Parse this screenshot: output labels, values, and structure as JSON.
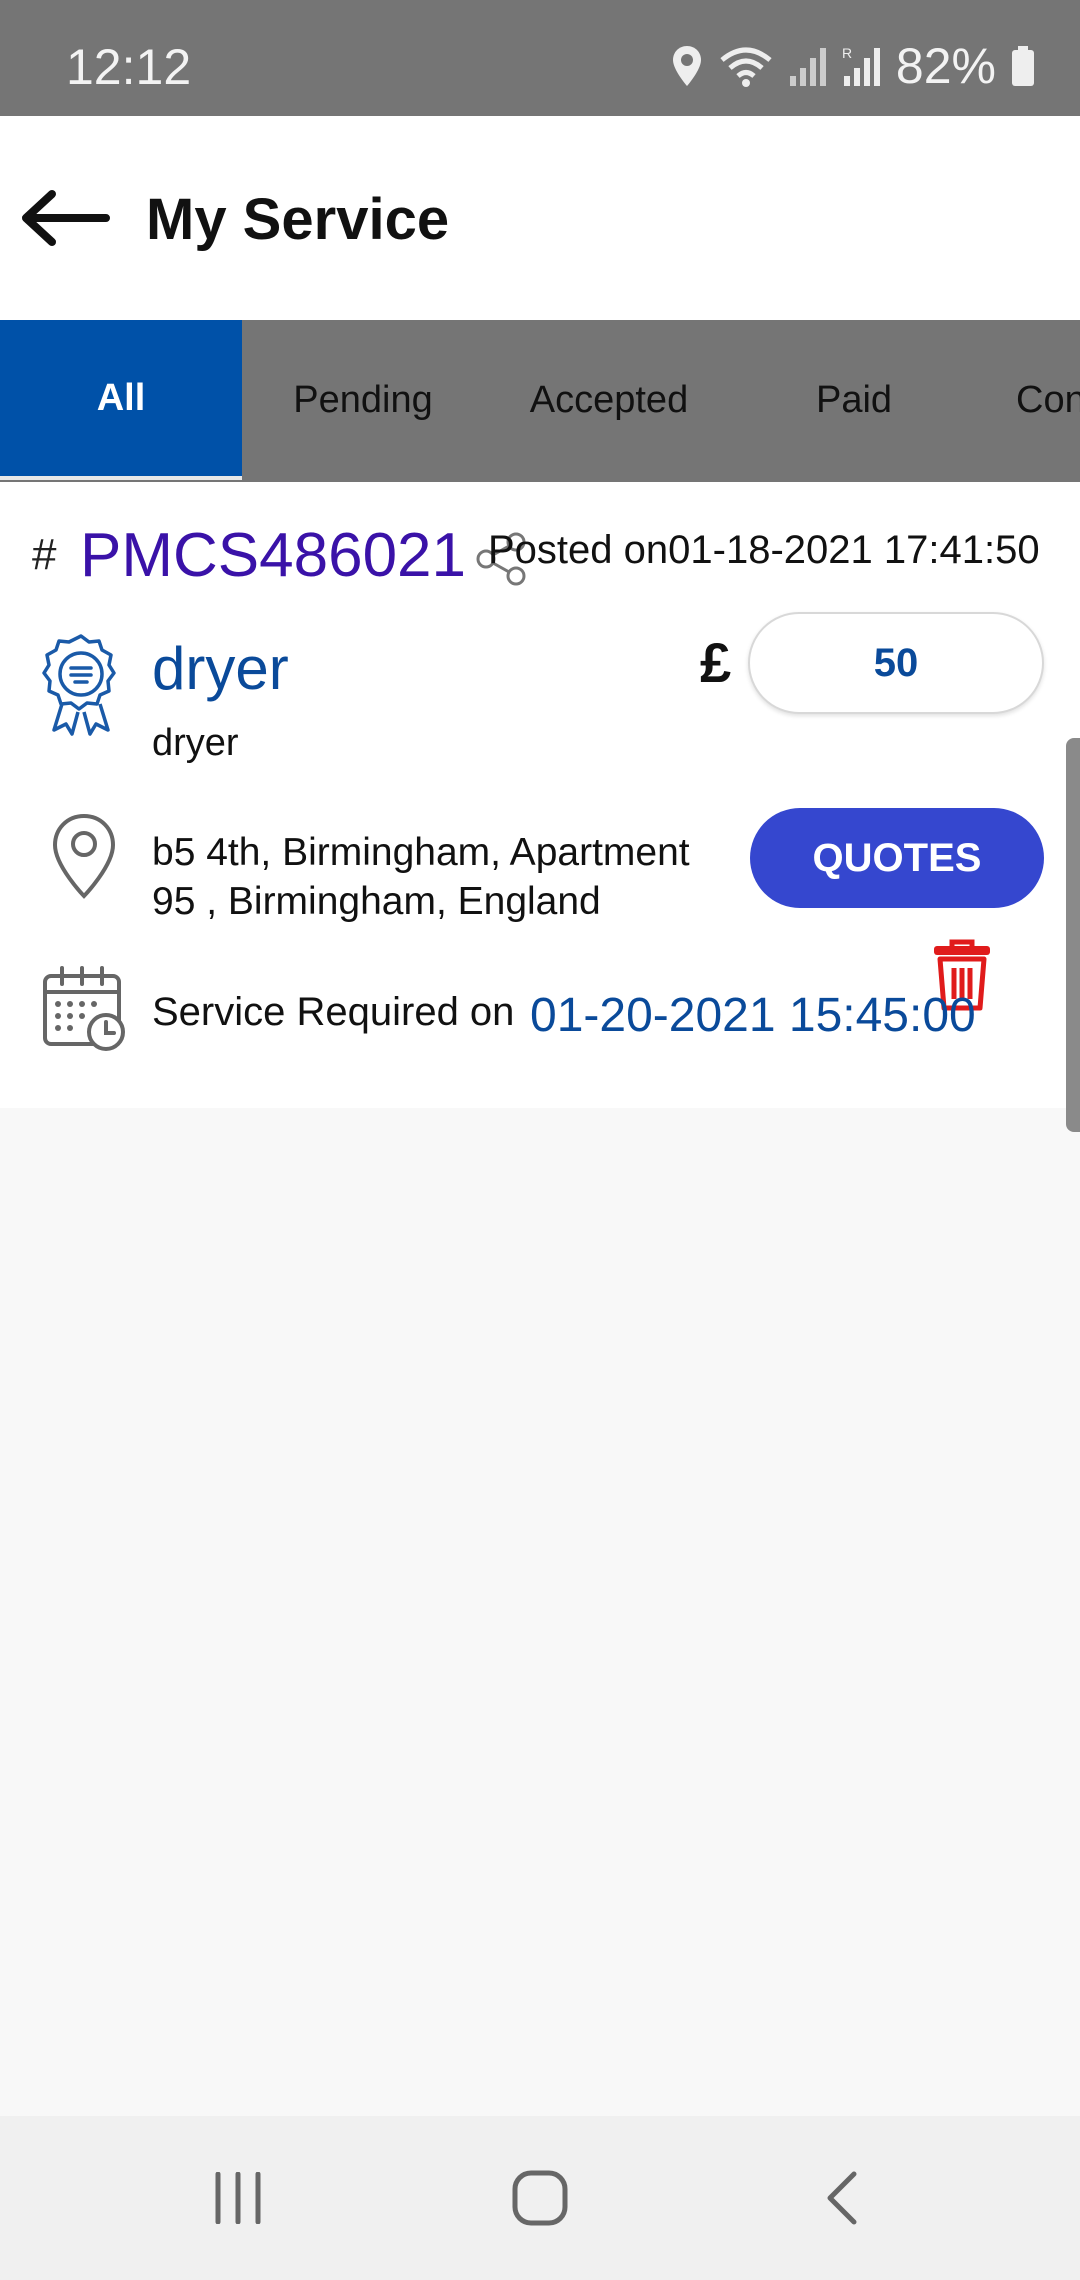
{
  "status_bar": {
    "time": "12:12",
    "battery": "82%"
  },
  "header": {
    "title": "My Service"
  },
  "tabs": [
    {
      "label": "All",
      "active": true
    },
    {
      "label": "Pending",
      "active": false
    },
    {
      "label": "Accepted",
      "active": false
    },
    {
      "label": "Paid",
      "active": false
    },
    {
      "label": "Con",
      "active": false
    }
  ],
  "service": {
    "hash": "#",
    "id": "PMCS486021",
    "posted": "Posted on01-18-2021 17:41:50",
    "name": "dryer",
    "description": "dryer",
    "currency": "£",
    "price": "50",
    "address_line1": "b5 4th, Birmingham, Apartment",
    "address_line2": "95 , Birmingham, England",
    "quotes_label": "QUOTES",
    "required_label": "Service Required on",
    "required_date": "01-20-2021 15:45:00"
  },
  "colors": {
    "accent": "#0051a8",
    "id_color": "#3a12a8",
    "button": "#3547cf",
    "delete": "#e01b1b"
  }
}
